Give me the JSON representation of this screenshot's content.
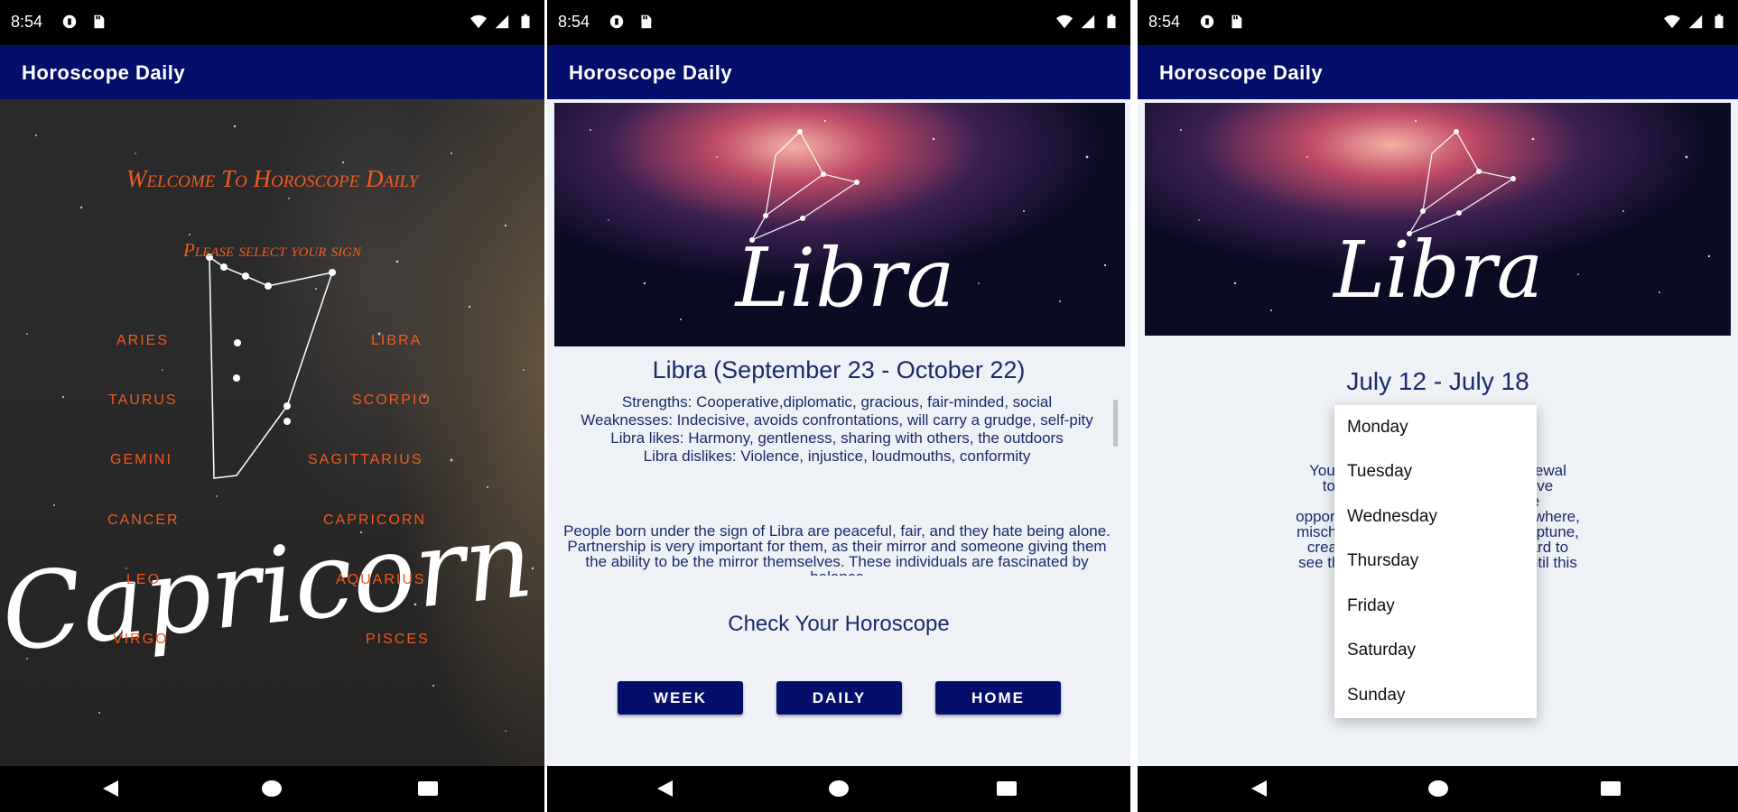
{
  "status": {
    "time": "8:54"
  },
  "app": {
    "title": "Horoscope Daily"
  },
  "screen1": {
    "welcome": "Welcome To Horoscope Daily",
    "prompt": "Please select your sign",
    "signs_left": [
      "ARIES",
      "TAURUS",
      "GEMINI",
      "CANCER",
      "LEO",
      "VIRGO"
    ],
    "signs_right": [
      "LIBRA",
      "SCORPIO",
      "SAGITTARIUS",
      "CAPRICORN",
      "AQUARIUS",
      "PISCES"
    ],
    "art_text": "Capricorn"
  },
  "screen2": {
    "hero_text": "Libra",
    "sign_title": "Libra (September 23 - October 22)",
    "traits": [
      "Strengths: Cooperative,diplomatic, gracious, fair-minded, social",
      "Weaknesses: Indecisive, avoids confrontations, will carry a grudge, self-pity",
      "Libra likes: Harmony, gentleness, sharing with others, the outdoors",
      "Libra dislikes: Violence, injustice, loudmouths, conformity"
    ],
    "about": "People born under the sign of Libra are peaceful, fair, and they hate being alone. Partnership is very important for them, as their mirror and someone giving them the ability to be the mirror themselves. These individuals are fascinated by balance",
    "check_heading": "Check Your Horoscope",
    "buttons": {
      "week": "WEEK",
      "daily": "DAILY",
      "home": "HOME"
    }
  },
  "screen3": {
    "hero_text": "Libra",
    "week_range": "July 12 - July 18",
    "horoscope_lines": [
      "Your intimate relat chance for renewal",
      "today, Libra. The into a supportive",
      "alignment with us, offering the",
      "opportunity for brea antic ruts. Elsewhere,",
      "mischievous Mercur ity-bending Neptune,",
      "creating a foggy m can make it hard to",
      "see things clearly. H y getaways until this",
      "."
    ],
    "days": [
      "Monday",
      "Tuesday",
      "Wednesday",
      "Thursday",
      "Friday",
      "Saturday",
      "Sunday"
    ]
  },
  "icons": {
    "status_left": [
      "notification-icon",
      "sd-card-icon"
    ],
    "status_right": [
      "wifi-icon",
      "signal-icon",
      "battery-icon"
    ],
    "nav": [
      "back-icon",
      "home-icon",
      "recents-icon"
    ]
  },
  "colors": {
    "app_bar": "#050f6b",
    "accent_orange": "#f05a1f",
    "text_navy": "#1c2a6b",
    "content_bg": "#eef1f6",
    "button": "#050f6b"
  }
}
